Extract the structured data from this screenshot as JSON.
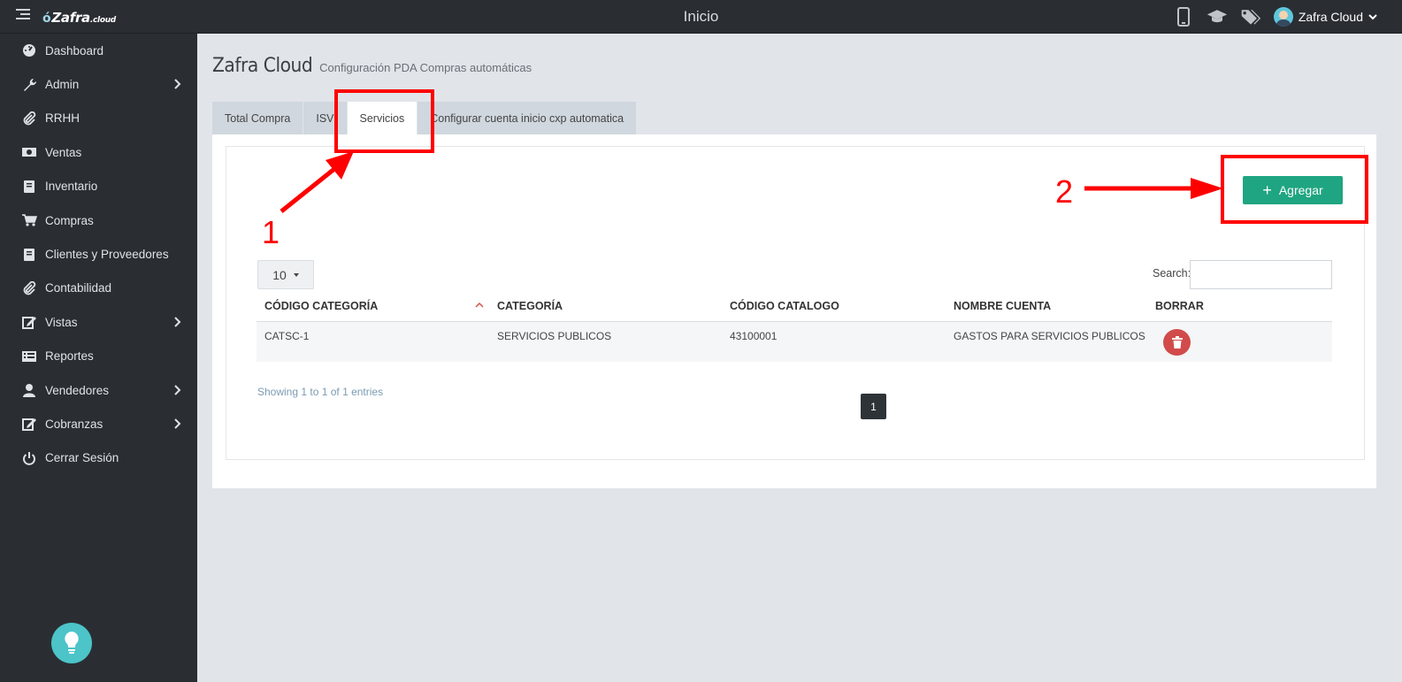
{
  "topbar": {
    "app_name": "Zafra",
    "app_suffix": ".cloud",
    "title": "Inicio",
    "user_name": "Zafra Cloud"
  },
  "sidebar": {
    "items": [
      {
        "label": "Dashboard",
        "icon": "dashboard-icon"
      },
      {
        "label": "Admin",
        "icon": "wrench-icon",
        "has_submenu": true
      },
      {
        "label": "RRHH",
        "icon": "paperclip-icon"
      },
      {
        "label": "Ventas",
        "icon": "money-icon"
      },
      {
        "label": "Inventario",
        "icon": "book-icon"
      },
      {
        "label": "Compras",
        "icon": "cart-icon"
      },
      {
        "label": "Clientes y Proveedores",
        "icon": "book-icon"
      },
      {
        "label": "Contabilidad",
        "icon": "paperclip-icon"
      },
      {
        "label": "Vistas",
        "icon": "edit-icon",
        "has_submenu": true
      },
      {
        "label": "Reportes",
        "icon": "list-icon"
      },
      {
        "label": "Vendedores",
        "icon": "user-icon",
        "has_submenu": true
      },
      {
        "label": "Cobranzas",
        "icon": "edit-icon",
        "has_submenu": true
      },
      {
        "label": "Cerrar Sesión",
        "icon": "power-icon"
      }
    ]
  },
  "header": {
    "title": "Zafra Cloud",
    "subtitle": "Configuración PDA Compras automáticas"
  },
  "tabs": [
    {
      "label": "Total Compra",
      "active": false
    },
    {
      "label": "ISV",
      "active": false
    },
    {
      "label": "Servicios",
      "active": true
    },
    {
      "label": "Configurar cuenta inicio cxp automatica",
      "active": false
    }
  ],
  "actions": {
    "add_label": "Agregar"
  },
  "table": {
    "page_length": "10",
    "search_label": "Search:",
    "search_value": "",
    "columns": [
      "CÓDIGO CATEGORÍA",
      "CATEGORÍA",
      "CÓDIGO CATALOGO",
      "NOMBRE CUENTA",
      "BORRAR"
    ],
    "rows": [
      [
        "CATSC-1",
        "SERVICIOS PUBLICOS",
        "43100001",
        "GASTOS PARA SERVICIOS PUBLICOS"
      ]
    ],
    "info": "Showing 1 to 1 of 1 entries",
    "current_page": "1"
  },
  "annotations": {
    "step1": "1",
    "step2": "2"
  },
  "colors": {
    "sidebar_bg": "#2a2e33",
    "accent_green": "#1fa581",
    "delete_red": "#d14b4b",
    "annotation_red": "#ff0000"
  }
}
